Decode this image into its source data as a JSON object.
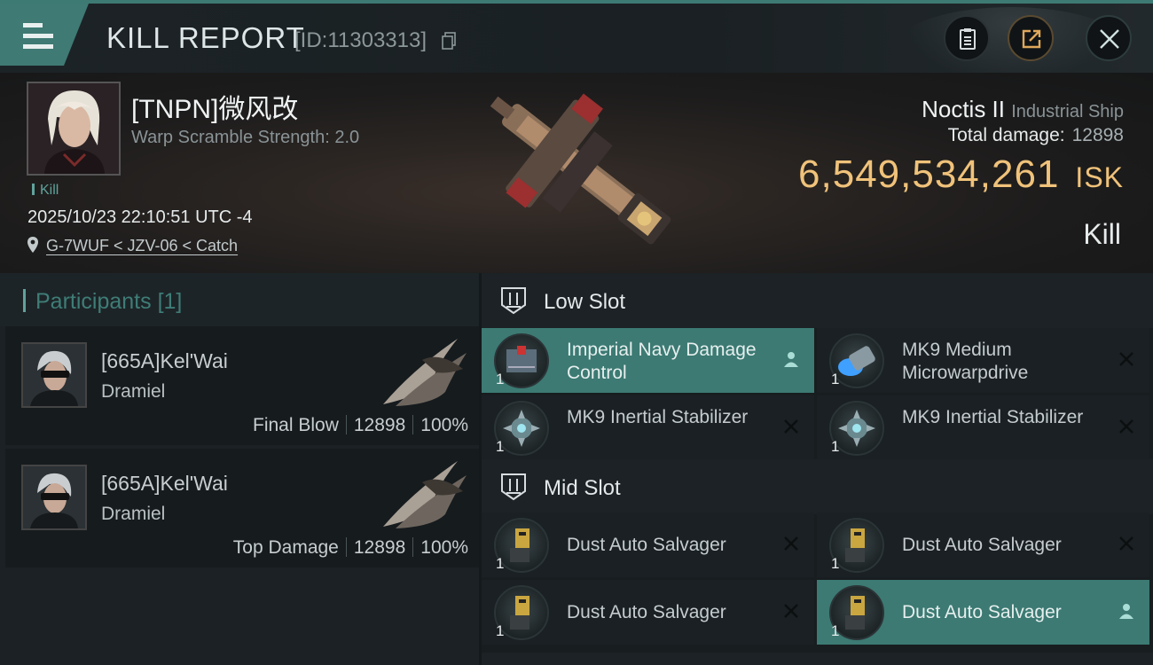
{
  "header": {
    "title": "KILL REPORT",
    "report_id": "[ID:11303313]",
    "buttons": {
      "clipboard": "clipboard-icon",
      "share": "share-icon",
      "close": "close-icon"
    }
  },
  "victim": {
    "name": "[TNPN]微风改",
    "warp_scramble": "Warp Scramble Strength: 2.0",
    "tag": "Kill",
    "datetime": "2025/10/23 22:10:51 UTC -4",
    "location": "G-7WUF < JZV-06 < Catch"
  },
  "ship": {
    "name": "Noctis II",
    "class": "Industrial Ship",
    "total_damage_label": "Total damage:",
    "total_damage": "12898",
    "isk_value": "6,549,534,261",
    "isk_unit": "ISK",
    "result": "Kill"
  },
  "participants": {
    "title": "Participants",
    "count": "[1]",
    "list": [
      {
        "name": "[665A]Kel'Wai",
        "ship": "Dramiel",
        "role": "Final Blow",
        "damage": "12898",
        "percent": "100%"
      },
      {
        "name": "[665A]Kel'Wai",
        "ship": "Dramiel",
        "role": "Top Damage",
        "damage": "12898",
        "percent": "100%"
      }
    ]
  },
  "fitting": {
    "low_slot": {
      "title": "Low Slot",
      "modules": [
        {
          "name": "Imperial Navy Damage Control",
          "qty": "1",
          "status": "person-icon"
        },
        {
          "name": "MK9 Medium Microwarpdrive",
          "qty": "1",
          "status": "x-icon"
        },
        {
          "name": "MK9 Inertial Stabilizer",
          "qty": "1",
          "status": "x-icon"
        },
        {
          "name": "MK9 Inertial Stabilizer",
          "qty": "1",
          "status": "x-icon"
        }
      ]
    },
    "mid_slot": {
      "title": "Mid Slot",
      "modules": [
        {
          "name": "Dust Auto Salvager",
          "qty": "1",
          "status": "x-icon"
        },
        {
          "name": "Dust Auto Salvager",
          "qty": "1",
          "status": "x-icon"
        },
        {
          "name": "Dust Auto Salvager",
          "qty": "1",
          "status": "x-icon"
        },
        {
          "name": "Dust Auto Salvager",
          "qty": "1",
          "status": "person-icon"
        }
      ]
    }
  },
  "colors": {
    "accent_teal": "#3f7a74",
    "isk_gold": "#f0c27a",
    "highlight_row": "#3c7a73"
  }
}
